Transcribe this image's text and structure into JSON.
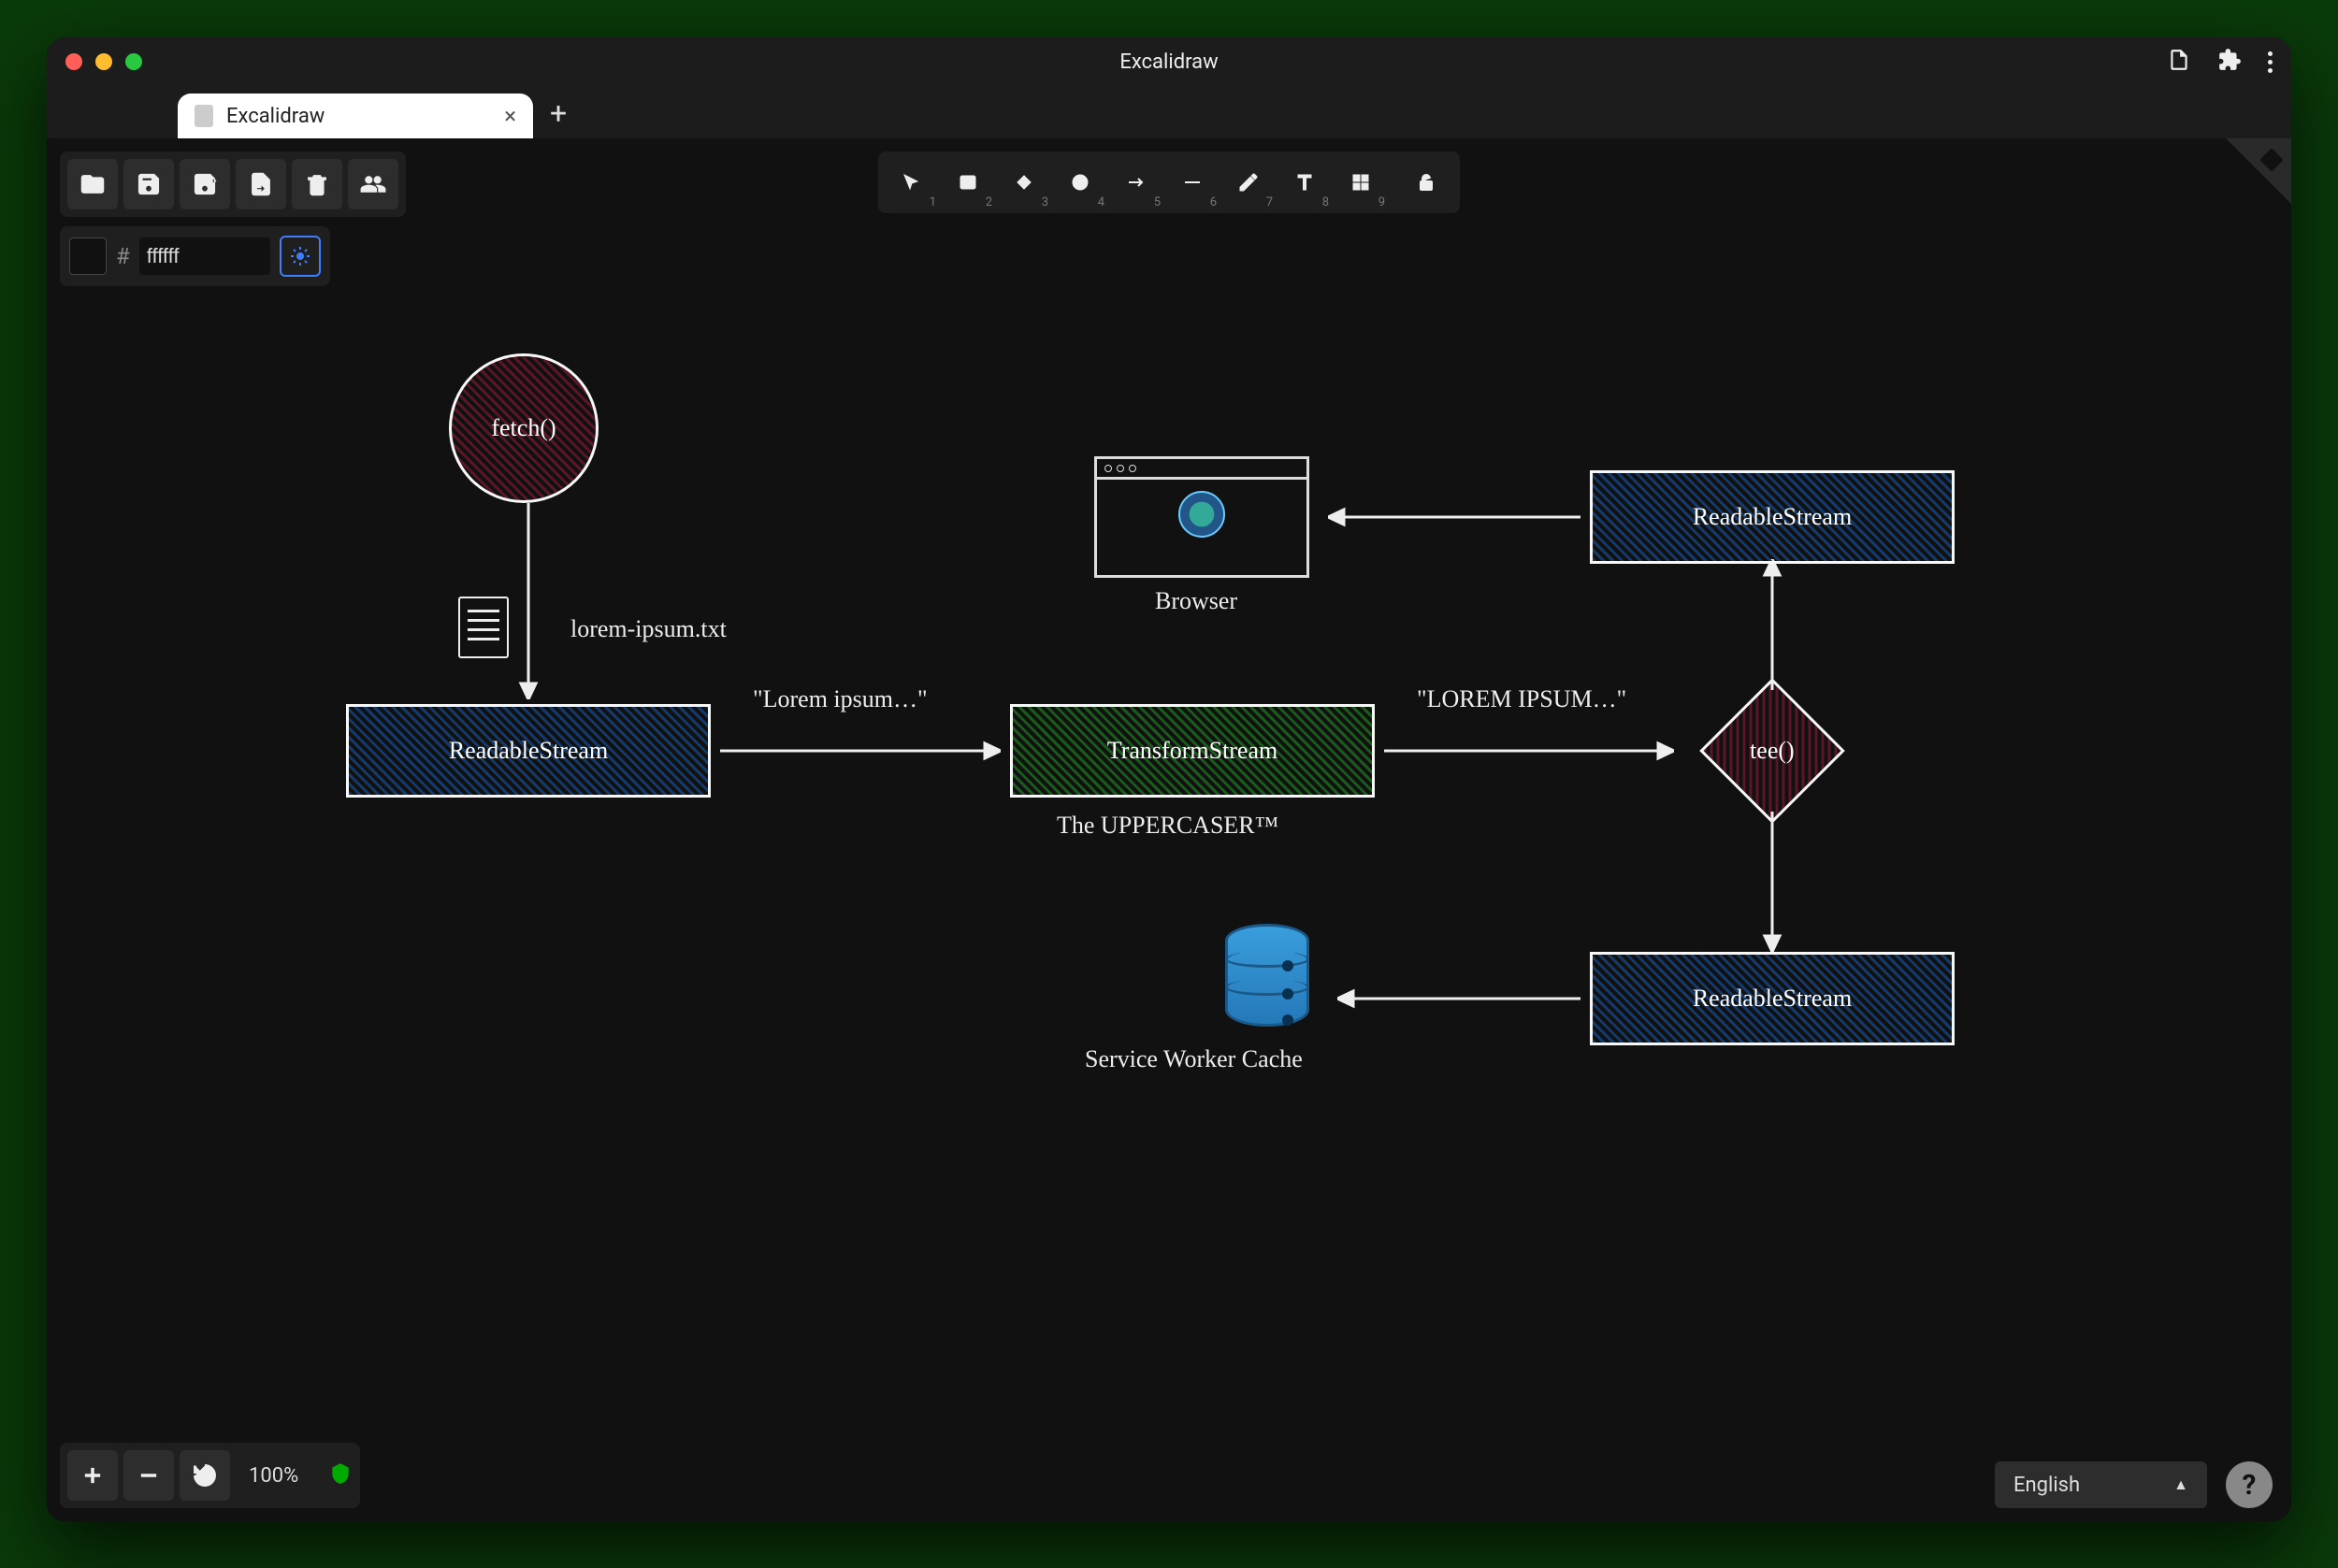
{
  "window": {
    "title": "Excalidraw"
  },
  "tab": {
    "label": "Excalidraw"
  },
  "color": {
    "hash": "#",
    "value": "ffffff"
  },
  "tools": {
    "nums": [
      "1",
      "2",
      "3",
      "4",
      "5",
      "6",
      "7",
      "8",
      "9"
    ]
  },
  "zoom": {
    "label": "100%"
  },
  "lang": {
    "label": "English"
  },
  "diagram": {
    "fetch": "fetch()",
    "file_label": "lorem-ipsum.txt",
    "readable1": "ReadableStream",
    "lorem_lower": "\"Lorem ipsum…\"",
    "transform": "TransformStream",
    "uppercaser": "The UPPERCASER™",
    "lorem_upper": "\"LOREM IPSUM…\"",
    "tee": "tee()",
    "readable2": "ReadableStream",
    "browser": "Browser",
    "readable3": "ReadableStream",
    "swcache": "Service Worker Cache"
  }
}
